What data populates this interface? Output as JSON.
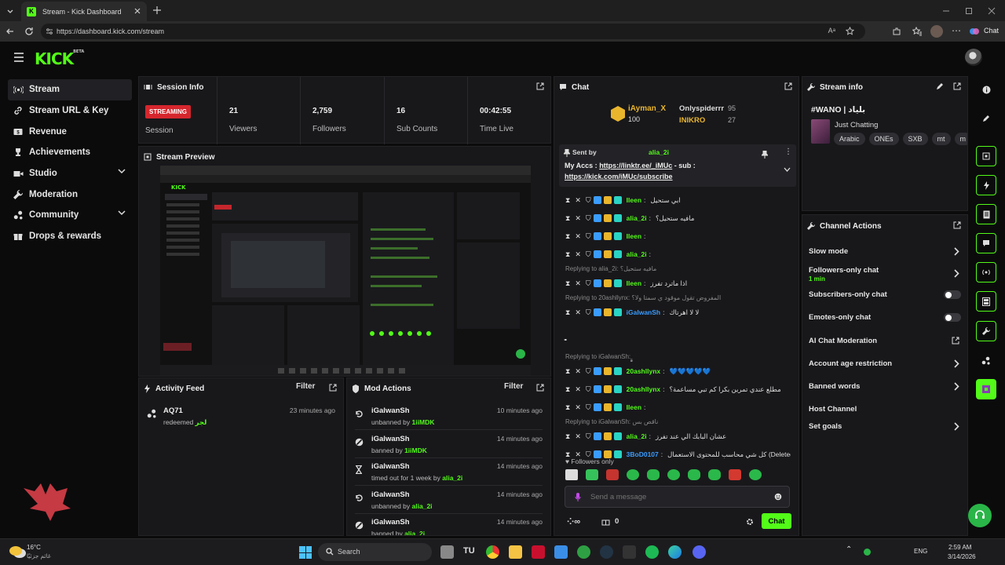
{
  "browser": {
    "tab_title": "Stream - Kick Dashboard",
    "url": "https://dashboard.kick.com/stream",
    "chat_label": "Chat"
  },
  "app": {
    "logo": "KICK",
    "logo_sup": "BETA"
  },
  "sidebar": {
    "items": [
      {
        "label": "Stream",
        "icon": "broadcast-icon",
        "active": true
      },
      {
        "label": "Stream URL & Key",
        "icon": "link-icon"
      },
      {
        "label": "Revenue",
        "icon": "dollar-icon"
      },
      {
        "label": "Achievements",
        "icon": "trophy-icon"
      },
      {
        "label": "Studio",
        "icon": "video-icon",
        "expandable": true
      },
      {
        "label": "Moderation",
        "icon": "wrench-icon"
      },
      {
        "label": "Community",
        "icon": "users-icon",
        "expandable": true
      },
      {
        "label": "Drops & rewards",
        "icon": "gift-icon"
      }
    ]
  },
  "session": {
    "title": "Session Info",
    "status_badge": "STREAMING",
    "status_label": "Session",
    "stats": [
      {
        "value": "21",
        "label": "Viewers"
      },
      {
        "value": "2,759",
        "label": "Followers"
      },
      {
        "value": "16",
        "label": "Sub Counts"
      },
      {
        "value": "00:42:55",
        "label": "Time Live"
      }
    ]
  },
  "preview": {
    "title": "Stream Preview"
  },
  "activity": {
    "title": "Activity Feed",
    "filter": "Filter",
    "items": [
      {
        "user": "AQ71",
        "action": "redeemed",
        "reward": "لجر",
        "time": "23 minutes ago"
      }
    ]
  },
  "mod_actions": {
    "title": "Mod Actions",
    "filter": "Filter",
    "items": [
      {
        "user": "iGalwanSh",
        "action": "unbanned by",
        "by": "1iiMDK",
        "time": "10 minutes ago",
        "icon": "undo-icon"
      },
      {
        "user": "iGalwanSh",
        "action": "banned by",
        "by": "1iiMDK",
        "time": "14 minutes ago",
        "icon": "ban-icon"
      },
      {
        "user": "iGalwanSh",
        "action": "timed out for 1 week by",
        "by": "alia_2i",
        "time": "14 minutes ago",
        "icon": "hourglass-icon"
      },
      {
        "user": "iGalwanSh",
        "action": "unbanned by",
        "by": "alia_2i",
        "time": "14 minutes ago",
        "icon": "undo-icon"
      },
      {
        "user": "iGalwanSh",
        "action": "banned by",
        "by": "alia_2i",
        "time": "14 minutes ago",
        "icon": "ban-icon"
      }
    ]
  },
  "chat": {
    "title": "Chat",
    "leaderboard": {
      "top_user": "iAyman_X",
      "top_value": "100",
      "others": [
        {
          "name": "Onlyspiderrr",
          "value": "95"
        },
        {
          "name": "INIKRO",
          "value": "27"
        }
      ]
    },
    "pinned": {
      "sent_by_label": "Sent by",
      "sender": "alia_2i",
      "text": "My Accs : ",
      "link1": "https://linktr.ee/_iMUc",
      "mid": " - sub :",
      "link2": "https://kick.com/iMUc/subscribe"
    },
    "messages": [
      {
        "user": "Ileen",
        "color": "#53fc18",
        "text": "ابي ستحيل"
      },
      {
        "user": "alia_2i",
        "color": "#53fc18",
        "text": "مافيه ستحيل؟"
      },
      {
        "user": "Ileen",
        "color": "#53fc18",
        "text": ""
      },
      {
        "user": "alia_2i",
        "color": "#53fc18",
        "text": ""
      },
      {
        "reply": "Replying to alia_2i: مافيه ستحيل؟",
        "user": "Ileen",
        "color": "#53fc18",
        "text": "اذا ماترد تفرز"
      },
      {
        "reply": "Replying to 20ashllynx: المفروض تقول موقود ي سمتا ولا؟",
        "user": "iGalwanSh",
        "color": "#3b9cff",
        "text": "لا لا اهرتاك"
      },
      {
        "user": "",
        "color": "#ddd",
        "text": "ٍٍٍٍٍٍٍٍٍٍٍٍٍٍٍٍٍٍٍٍٍٍٍٍٍٍٍٍٍٍٍٍٍٍٍٍٍٍٍٍٍٍٍٍٍٍٍٍٍٍٍٍٍٍٍٍٍٍٍٍٍٍٍٍٍٍٍٍٍٍٍٍٍٍ"
      },
      {
        "reply": "Replying to iGalwanSh: ٍٍٍٍٍٍٍٍٍٍٍٍٍٍٍٍٍٍٍٍٍٍٍٍٍٍٍٍٍٍٍٍٍٍٍٍٍٍٍٍٍٍٍٍٍ",
        "user": "20ashllynx",
        "color": "#53fc18",
        "text": "💙💙💙💙💙"
      },
      {
        "user": "20ashllynx",
        "color": "#53fc18",
        "text": "مطلع عندي تمرين بكرا كم تبي مساعمة؟"
      },
      {
        "user": "Ileen",
        "color": "#53fc18",
        "text": ""
      },
      {
        "reply": "Replying to iGalwanSh: ناقص بس",
        "user": "alia_2i",
        "color": "#53fc18",
        "text": "عشان البابك الي عند تفرز"
      },
      {
        "user": "3BoD0107",
        "color": "#3b9cff",
        "text": "كل شي محاسب للمحتوى الاستعمال (Deleted)"
      }
    ],
    "followers_only": "Followers only",
    "input_placeholder": "Send a message",
    "count": "0",
    "send_label": "Chat"
  },
  "stream_info": {
    "title": "Stream info",
    "stream_title": "#WANO | بلياد",
    "category": "Just Chatting",
    "tags": [
      "Arabic",
      "ONEs",
      "SXB",
      "mt",
      "m"
    ]
  },
  "channel_actions": {
    "title": "Channel Actions",
    "rows": [
      {
        "label": "Slow mode",
        "type": "chevron"
      },
      {
        "label": "Followers-only chat",
        "sub": "1 min",
        "type": "chevron"
      },
      {
        "label": "Subscribers-only chat",
        "type": "toggle"
      },
      {
        "label": "Emotes-only chat",
        "type": "toggle"
      },
      {
        "label": "AI Chat Moderation",
        "type": "external"
      },
      {
        "label": "Account age restriction",
        "type": "chevron"
      },
      {
        "label": "Banned words",
        "type": "chevron"
      },
      {
        "label": "Host Channel",
        "type": "none"
      },
      {
        "label": "Set goals",
        "type": "chevron"
      }
    ]
  },
  "taskbar": {
    "weather_temp": "16°C",
    "weather_desc": "غائم جزئيًا",
    "search": "Search",
    "lang": "ENG",
    "time": "2:59 AM",
    "date": "3/14/2026"
  },
  "colors": {
    "accent": "#53fc18",
    "danger": "#e0282f",
    "panel": "#18181b"
  }
}
